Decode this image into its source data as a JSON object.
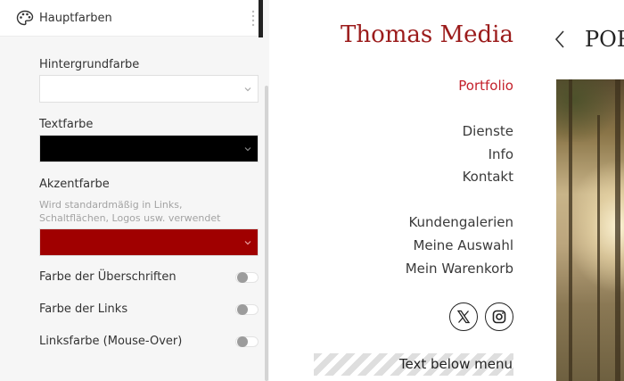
{
  "panel": {
    "header_title": "Hauptfarben",
    "fields": {
      "background": {
        "label": "Hintergrundfarbe",
        "color": "#ffffff"
      },
      "text": {
        "label": "Textfarbe",
        "color": "#000000"
      },
      "accent": {
        "label": "Akzentfarbe",
        "hint": "Wird standardmäßig in Links, Schaltflächen, Logos usw. verwendet",
        "color": "#a00000"
      }
    },
    "toggles": [
      {
        "label": "Farbe der Überschriften",
        "on": false
      },
      {
        "label": "Farbe der Links",
        "on": false
      },
      {
        "label": "Linksfarbe (Mouse-Over)",
        "on": false
      }
    ]
  },
  "site": {
    "title": "Thomas Media",
    "nav": [
      "Portfolio",
      "Dienste",
      "Info",
      "Kontakt",
      "Kundengalerien",
      "Meine Auswahl",
      "Mein Warenkorb"
    ],
    "active_nav": "Portfolio",
    "social": [
      "x-icon",
      "instagram-icon"
    ],
    "text_below_menu": "Text below menu",
    "page_heading": "POR",
    "colors": {
      "title": "#9b1b1b",
      "active_link": "#c4212b"
    }
  }
}
